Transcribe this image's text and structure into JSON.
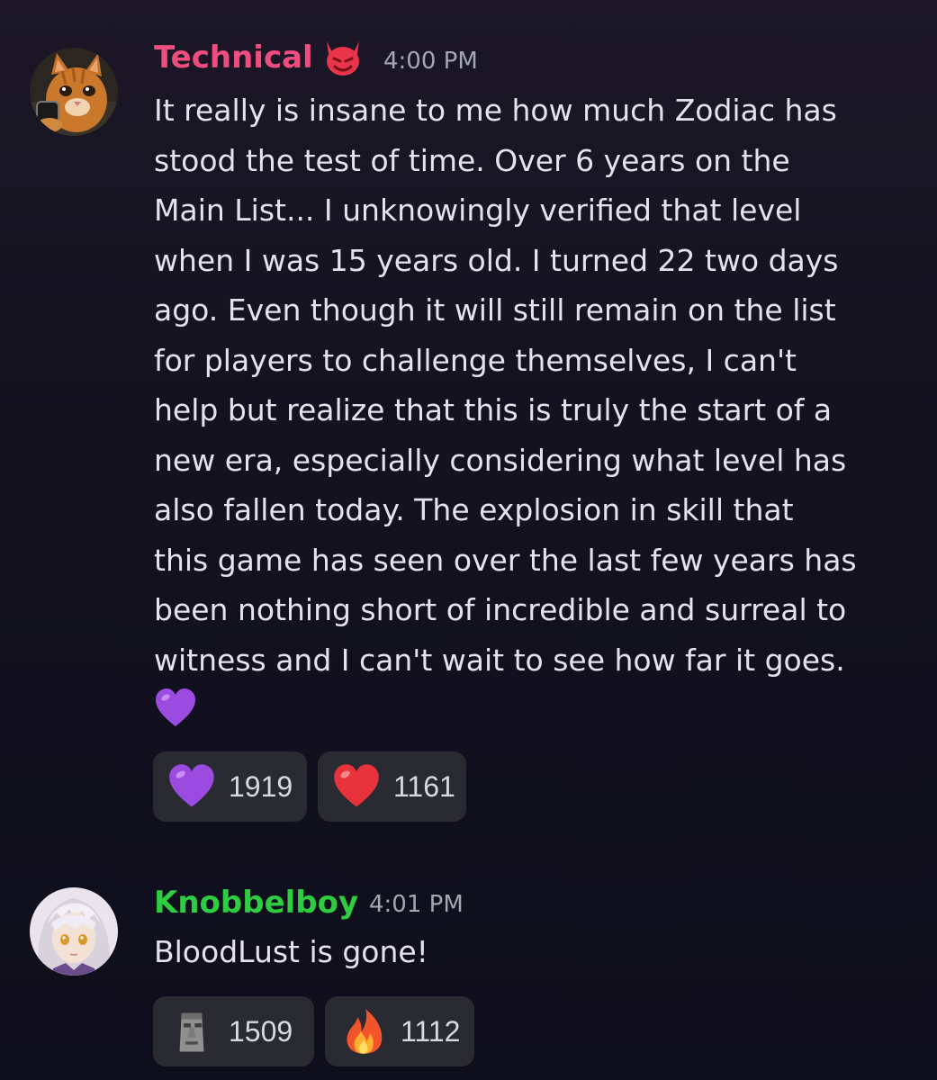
{
  "messages": [
    {
      "username": "Technical",
      "username_color": "#ef4d7d",
      "badge_icon": "devil-face-icon",
      "timestamp": "4:00 PM",
      "avatar_icon": "orange-cat-avatar",
      "lines": [
        "It really is insane to me how much Zodiac has",
        "stood the test of time. Over 6 years on the",
        "Main List... I unknowingly verified that level",
        "when I was 15 years old. I turned 22 two days",
        "ago. Even though it will still remain on the list",
        "for players to challenge themselves, I can't",
        "help but realize that this is truly the start of a",
        "new era, especially considering what level has",
        "also fallen today. The explosion in skill that",
        "this game has seen over the last few years has",
        "been nothing short of incredible and surreal to",
        "witness and I can't wait to see how far it goes."
      ],
      "trailing_emoji": "purple-heart-icon",
      "reactions": [
        {
          "emoji": "purple-heart-icon",
          "count": "1919"
        },
        {
          "emoji": "red-heart-icon",
          "count": "1161"
        }
      ]
    },
    {
      "username": "Knobbelboy",
      "username_color": "#2ecc40",
      "timestamp": "4:01 PM",
      "avatar_icon": "anime-girl-avatar",
      "lines": [
        "BloodLust is gone!"
      ],
      "reactions": [
        {
          "emoji": "moai-icon",
          "count": "1509"
        },
        {
          "emoji": "fire-icon",
          "count": "1112"
        }
      ]
    }
  ]
}
